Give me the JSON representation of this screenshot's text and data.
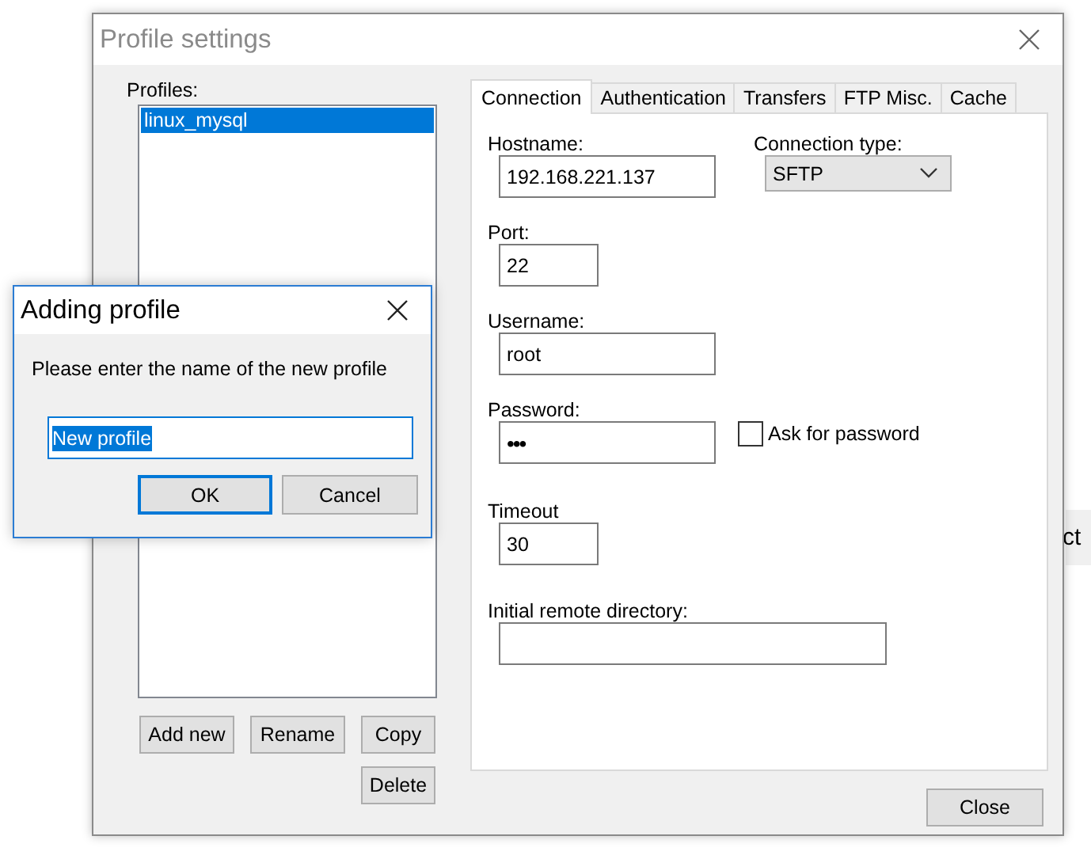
{
  "background_window": {
    "text": "ct"
  },
  "window": {
    "title": "Profile settings"
  },
  "profiles": {
    "label": "Profiles:",
    "items": [
      {
        "name": "linux_mysql",
        "selected": true
      }
    ]
  },
  "profile_buttons": [
    "Add new",
    "Rename",
    "Copy",
    "Delete"
  ],
  "tabs": [
    {
      "label": "Connection",
      "selected": true
    },
    {
      "label": "Authentication",
      "selected": false
    },
    {
      "label": "Transfers",
      "selected": false
    },
    {
      "label": "FTP Misc.",
      "selected": false
    },
    {
      "label": "Cache",
      "selected": false
    }
  ],
  "connection": {
    "hostname": {
      "label": "Hostname:",
      "value": "192.168.221.137"
    },
    "connection_type": {
      "label": "Connection type:",
      "value": "SFTP"
    },
    "port": {
      "label": "Port:",
      "value": "22"
    },
    "username": {
      "label": "Username:",
      "value": "root"
    },
    "password": {
      "label": "Password:",
      "value": "•••"
    },
    "ask_for_password": {
      "label": "Ask for password",
      "checked": false
    },
    "timeout": {
      "label": "Timeout",
      "value": "30"
    },
    "initial_remote_directory": {
      "label": "Initial remote directory:"
    }
  },
  "close_button": "Close",
  "dialog": {
    "title": "Adding profile",
    "prompt": "Please enter the name of the new profile",
    "input": {
      "value": "New profile",
      "selected": true
    },
    "buttons": [
      {
        "label": "OK",
        "default": true
      },
      {
        "label": "Cancel",
        "default": false
      }
    ]
  }
}
